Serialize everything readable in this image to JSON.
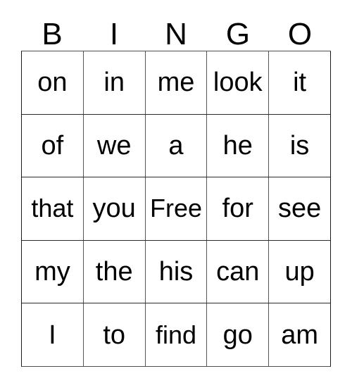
{
  "card": {
    "header": {
      "letters": [
        "B",
        "I",
        "N",
        "G",
        "O"
      ]
    },
    "grid": {
      "rows": [
        {
          "cells": [
            {
              "text": "on"
            },
            {
              "text": "in"
            },
            {
              "text": "me"
            },
            {
              "text": "look"
            },
            {
              "text": "it"
            }
          ]
        },
        {
          "cells": [
            {
              "text": "of"
            },
            {
              "text": "we"
            },
            {
              "text": "a"
            },
            {
              "text": "he"
            },
            {
              "text": "is"
            }
          ]
        },
        {
          "cells": [
            {
              "text": "that"
            },
            {
              "text": "you"
            },
            {
              "text": "Free"
            },
            {
              "text": "for"
            },
            {
              "text": "see"
            }
          ]
        },
        {
          "cells": [
            {
              "text": "my"
            },
            {
              "text": "the"
            },
            {
              "text": "his"
            },
            {
              "text": "can"
            },
            {
              "text": "up"
            }
          ]
        },
        {
          "cells": [
            {
              "text": "I"
            },
            {
              "text": "to"
            },
            {
              "text": "find"
            },
            {
              "text": "go"
            },
            {
              "text": "am"
            }
          ]
        }
      ]
    },
    "colors": {
      "background": "#ffffff",
      "text": "#000000",
      "grid_line": "#555555",
      "grid_border": "#1a1a1a"
    }
  }
}
